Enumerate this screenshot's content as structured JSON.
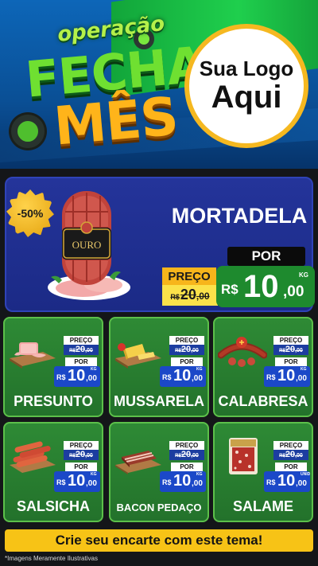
{
  "header": {
    "title_line1": "operação",
    "title_line2": "FECHA",
    "title_line3": "MÊS",
    "logo_line1": "Sua Logo",
    "logo_line2": "Aqui"
  },
  "featured": {
    "discount": "-50%",
    "name": "MORTADELA",
    "package_brand": "OURO",
    "price_label": "PREÇO",
    "old_currency": "R$",
    "old_int": "20",
    "old_dec": ",00",
    "por_label": "POR",
    "new_currency": "R$",
    "new_int": "10",
    "new_dec": ",00",
    "unit": "KG"
  },
  "products": [
    {
      "name": "PRESUNTO",
      "price_label": "PREÇO",
      "old_currency": "R$",
      "old_int": "20",
      "old_dec": ",00",
      "por_label": "POR",
      "new_currency": "R$",
      "new_int": "10",
      "new_dec": ",00",
      "unit": "KG"
    },
    {
      "name": "MUSSARELA",
      "price_label": "PREÇO",
      "old_currency": "R$",
      "old_int": "20",
      "old_dec": ",00",
      "por_label": "POR",
      "new_currency": "R$",
      "new_int": "10",
      "new_dec": ",00",
      "unit": "KG"
    },
    {
      "name": "CALABRESA",
      "price_label": "PREÇO",
      "old_currency": "R$",
      "old_int": "20",
      "old_dec": ",00",
      "por_label": "POR",
      "new_currency": "R$",
      "new_int": "10",
      "new_dec": ",00",
      "unit": "KG"
    },
    {
      "name": "SALSICHA",
      "price_label": "PREÇO",
      "old_currency": "R$",
      "old_int": "20",
      "old_dec": ",00",
      "por_label": "POR",
      "new_currency": "R$",
      "new_int": "10",
      "new_dec": ",00",
      "unit": "KG"
    },
    {
      "name": "BACON PEDAÇO",
      "price_label": "PREÇO",
      "old_currency": "R$",
      "old_int": "20",
      "old_dec": ",00",
      "por_label": "POR",
      "new_currency": "R$",
      "new_int": "10",
      "new_dec": ",00",
      "unit": "KG"
    },
    {
      "name": "SALAME",
      "price_label": "PREÇO",
      "old_currency": "R$",
      "old_int": "20",
      "old_dec": ",00",
      "por_label": "POR",
      "new_currency": "R$",
      "new_int": "10",
      "new_dec": ",00",
      "unit": "UNID"
    }
  ],
  "footer": {
    "cta": "Crie seu encarte com este tema!",
    "disclaimer": "*Imagens Meramente Ilustrativas"
  }
}
